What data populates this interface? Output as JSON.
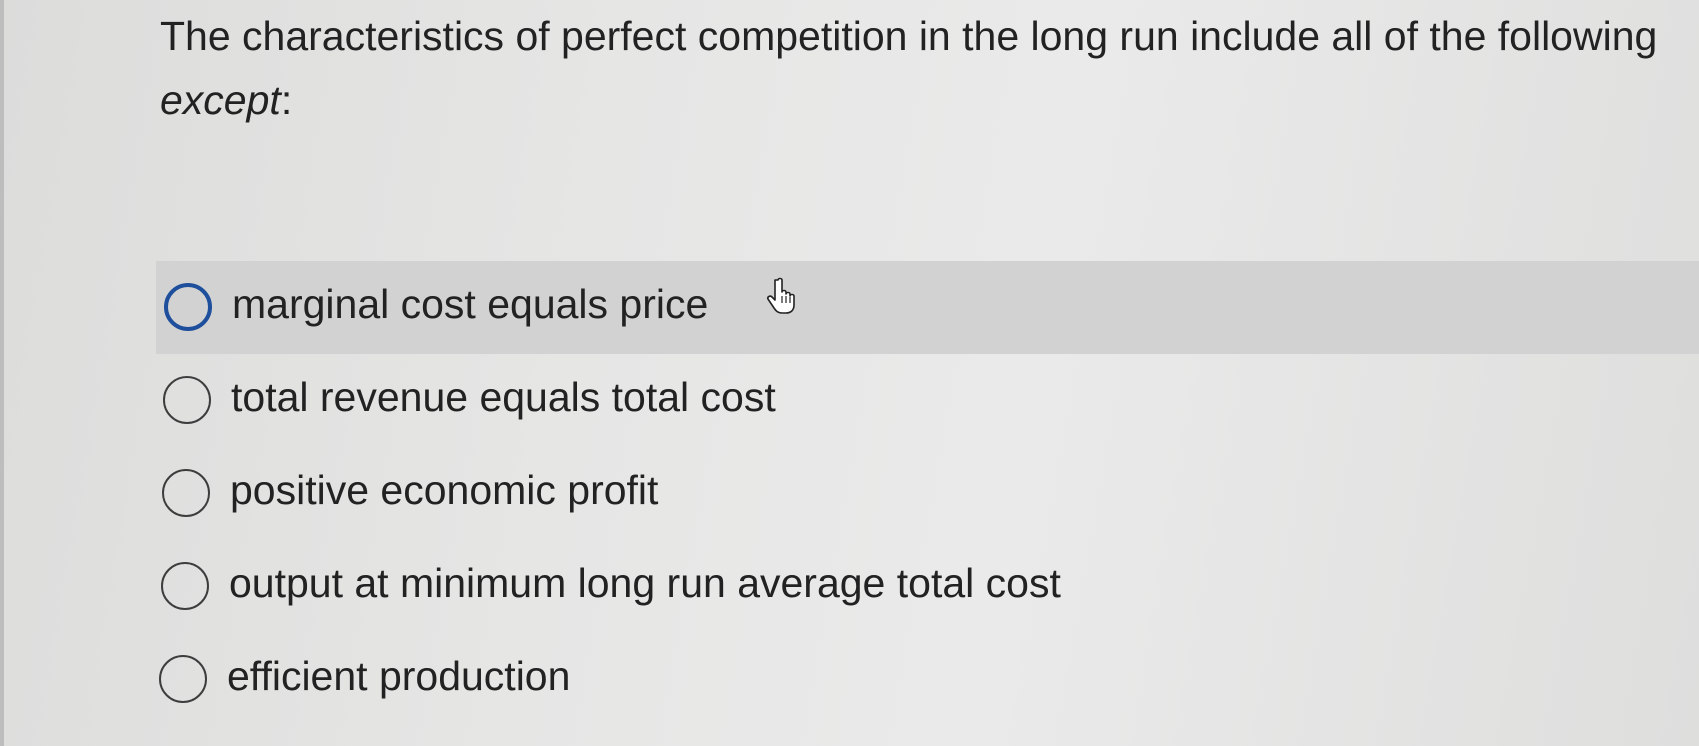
{
  "question": {
    "text_main": "The characteristics of perfect competition in the long run include all of the following ",
    "text_emphasis": "except",
    "text_end": ":"
  },
  "options": [
    {
      "label": "marginal cost equals price",
      "state": "hovered"
    },
    {
      "label": "total revenue equals total cost",
      "state": "default"
    },
    {
      "label": "positive economic profit",
      "state": "default"
    },
    {
      "label": "output at minimum long run average total cost",
      "state": "default"
    },
    {
      "label": "efficient production",
      "state": "default"
    }
  ],
  "colors": {
    "hover_background": "#d2d2d2",
    "hover_radio_border": "#1e4f9c"
  },
  "icons": {
    "cursor": "hand-pointer-icon"
  }
}
